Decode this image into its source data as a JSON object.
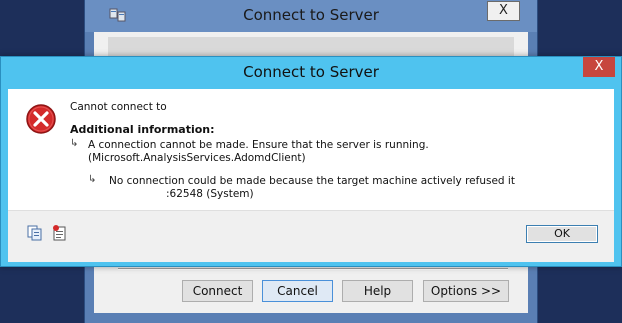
{
  "background_dialog": {
    "title": "Connect to Server",
    "close_label": "X",
    "buttons": {
      "connect": "Connect",
      "cancel": "Cancel",
      "help": "Help",
      "options": "Options >>"
    }
  },
  "error_dialog": {
    "title": "Connect to Server",
    "close_label": "X",
    "message": "Cannot connect to",
    "additional_heading": "Additional information:",
    "detail_1_line_1": "A connection cannot be made. Ensure that the server is running.",
    "detail_1_line_2": "(Microsoft.AnalysisServices.AdomdClient)",
    "detail_2_line_1": "No connection could be made because the target machine actively refused it",
    "detail_2_line_2": ":62548 (System)",
    "ok_label": "OK"
  },
  "icons": {
    "error": "error-circle-x-icon",
    "copy": "copy-icon",
    "details": "details-icon",
    "app": "server-connect-icon"
  },
  "colors": {
    "error_title_bar": "#4fc3ef",
    "error_close": "#c7463e",
    "background_title_bar": "#6a8fc2",
    "error_icon": "#d42a2a"
  }
}
